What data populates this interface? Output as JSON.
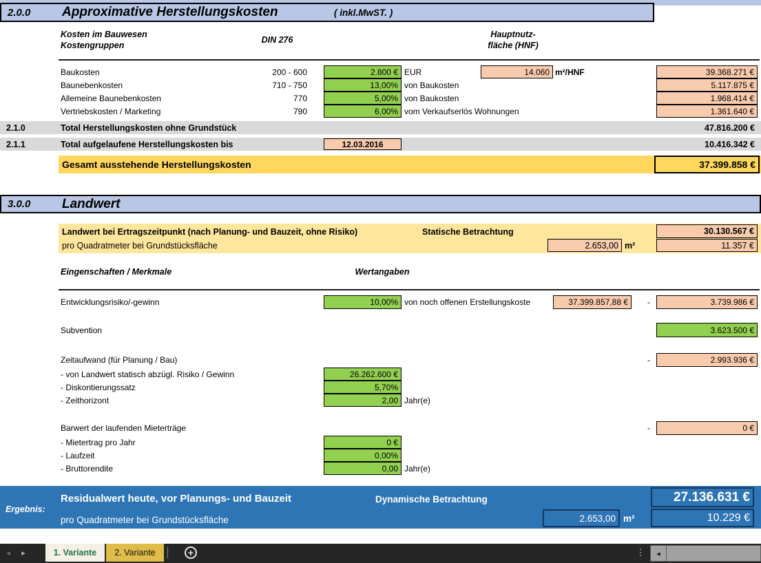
{
  "colors": {
    "header_band_blue": "#b9c7e6",
    "input_green": "#92d050",
    "value_orange": "#f8cbad",
    "total_gray": "#d9d9d9",
    "total_yellow": "#ffd75e",
    "band_yellow": "#ffe69d",
    "result_blue": "#2e75b6",
    "result_cell_border": "#17375e",
    "active_tab_text_green": "#217346",
    "tab2_gold": "#e0bd4a"
  },
  "s2": {
    "code": "2.0.0",
    "title": "Approximative Herstellungskosten",
    "suffix": "( inkl.MwST. )",
    "colhead": {
      "l1": "Kosten im Bauwesen",
      "l2": "Kostengruppen",
      "din": "DIN 276",
      "hnf1": "Hauptnutz-",
      "hnf2": "fläche (HNF)"
    },
    "hnf_value": "14.060",
    "hnf_unit": "m²/HNF",
    "rows": [
      {
        "label": "Baukosten",
        "din": "200 - 600",
        "input": "2.800 €",
        "note": "EUR",
        "total": "39.368.271 €"
      },
      {
        "label": "Baunebenkosten",
        "din": "710 - 750",
        "input": "13,00%",
        "note": "von Baukosten",
        "total": "5.117.875 €"
      },
      {
        "label": "Allemeine Baunebenkosten",
        "din": "770",
        "input": "5,00%",
        "note": "von Baukosten",
        "total": "1.968.414 €"
      },
      {
        "label": "Vertriebskosten / Marketing",
        "din": "790",
        "input": "6,00%",
        "note": "vom Verkaufserlös Wohnungen",
        "total": "1.361.640 €"
      }
    ],
    "total1": {
      "code": "2.1.0",
      "label": "Total Herstellungskosten ohne Grundstück",
      "value": "47.816.200 €"
    },
    "total2": {
      "code": "2.1.1",
      "label": "Total aufgelaufene Herstellungskosten bis",
      "date": "12.03.2016",
      "value": "10.416.342 €"
    },
    "gesamt": {
      "label": "Gesamt ausstehende Herstellungskosten",
      "value": "37.399.858 €"
    }
  },
  "s3": {
    "code": "3.0.0",
    "title": "Landwert",
    "band": {
      "line1": "Landwert bei Ertragszeitpunkt (nach Planung- und Bauzeit, ohne Risiko)",
      "mode": "Statische Betrachtung",
      "value1": "30.130.567 €",
      "line2": "pro Quadratmeter bei Grundstücksfläche",
      "area": "2.653,00",
      "unit": "m²",
      "value2": "11.357 €"
    },
    "headers": {
      "left": "Eingenschaften / Merkmale",
      "right": "Wertangaben"
    },
    "risk": {
      "label": "Entwicklungsrisiko/-gewinn",
      "input": "10,00%",
      "note": "von noch offenen Erstellungskoste",
      "ref": "37.399.857,88 €",
      "minus": "-",
      "value": "3.739.986 €"
    },
    "subvention": {
      "label": "Subvention",
      "value": "3.623.500 €"
    },
    "zeit": {
      "label": "Zeitaufwand (für Planung / Bau)",
      "minus": "-",
      "value": "2.993.936 €",
      "items": [
        {
          "label": "- von Landwert statisch abzügl. Risiko / Gewinn",
          "input": "26.262.600 €",
          "suffix": ""
        },
        {
          "label": "- Diskontierungssatz",
          "input": "5,70%",
          "suffix": ""
        },
        {
          "label": "- Zeithorizont",
          "input": "2,00",
          "suffix": "Jahr(e)"
        }
      ]
    },
    "barwert": {
      "label": "Barwert der laufenden Mieterträge",
      "minus": "-",
      "value": "0 €",
      "items": [
        {
          "label": "- Mietertrag pro Jahr",
          "input": "0 €",
          "suffix": ""
        },
        {
          "label": "- Laufzeit",
          "input": "0,00%",
          "suffix": ""
        },
        {
          "label": "- Bruttorendite",
          "input": "0,00",
          "suffix": "Jahr(e)"
        }
      ]
    }
  },
  "result": {
    "label": "Ergebnis:",
    "line1": "Residualwert heute, vor Planungs- und Bauzeit",
    "mode": "Dynamische Betrachtung",
    "value1": "27.136.631 €",
    "line2": "pro Quadratmeter bei Grundstücksfläche",
    "area": "2.653,00",
    "unit": "m²",
    "value2": "10.229 €"
  },
  "tabs": {
    "tab1": "1. Variante",
    "tab2": "2. Variante"
  },
  "icons": {
    "prev": "◂",
    "next": "▸",
    "add": "+",
    "more": "⋮",
    "scroll_left": "◂"
  }
}
